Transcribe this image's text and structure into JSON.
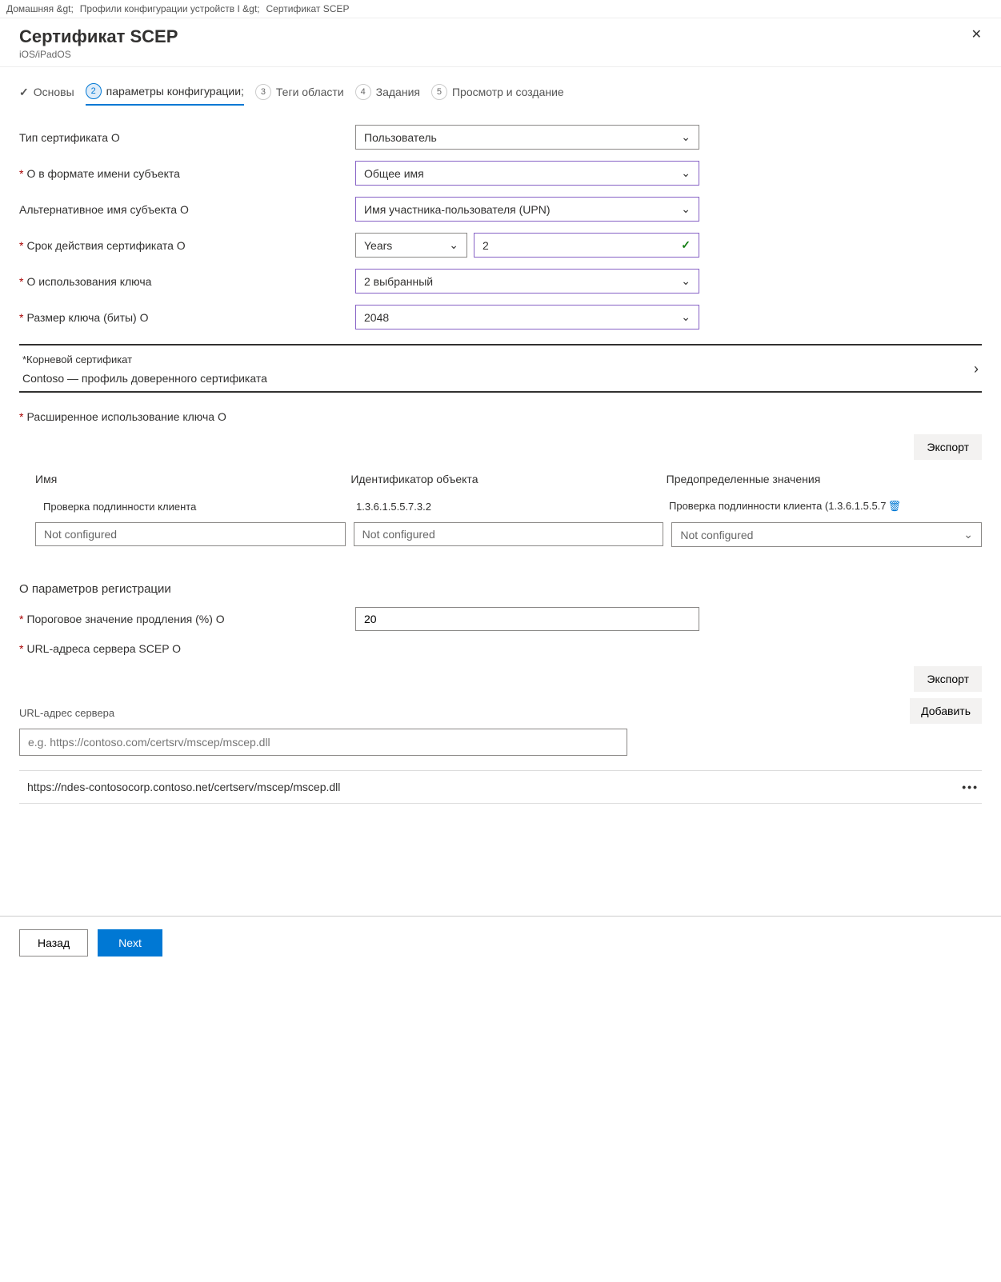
{
  "breadcrumb": {
    "home": "Домашняя &gt;",
    "profiles": "Профили конфигурации устройств I &gt;",
    "cert": "Сертификат SCEP"
  },
  "header": {
    "title": "Сертификат SCEP",
    "subtitle": "iOS/iPadOS"
  },
  "steps": {
    "s1": "Основы",
    "s2": "параметры конфигурации;",
    "s3": "Теги области",
    "s4": "Задания",
    "s5": "Просмотр и создание",
    "n3": "3",
    "n4": "4",
    "n5": "5",
    "n2": "2"
  },
  "fields": {
    "certType": {
      "label": "Тип сертификата О",
      "value": "Пользователь"
    },
    "subjectFormat": {
      "label": "О в формате имени субъекта",
      "value": "Общее имя"
    },
    "san": {
      "label": "Альтернативное имя субъекта О",
      "value": "Имя участника-пользователя (UPN)"
    },
    "validity": {
      "label": "Срок действия сертификата О",
      "unit": "Years",
      "value": "2"
    },
    "keyUsage": {
      "label": "О использования ключа",
      "value": "2 выбранный"
    },
    "keySize": {
      "label": "Размер ключа (биты) О",
      "value": "2048"
    },
    "rootCert": {
      "label": "*Корневой сертификат",
      "value": "Contoso — профиль доверенного сертификата"
    },
    "eku": {
      "label": "Расширенное использование ключа О"
    },
    "export": "Экспорт",
    "ekuTable": {
      "hName": "Имя",
      "hOid": "Идентификатор объекта",
      "hPredef": "Предопределенные значения",
      "rName": "Проверка подлинности клиента",
      "rOid": "1.3.6.1.5.5.7.3.2",
      "rPredef": "Проверка подлинности клиента (1.3.6.1.5.5.7",
      "notConfigured": "Not configured"
    },
    "enrollTitle": "О параметров регистрации",
    "renewal": {
      "label": "Пороговое значение продления (%) О",
      "value": "20"
    },
    "scepUrls": {
      "label": "URL-адреса сервера SCEP О"
    },
    "urlServerLabel": "URL-адрес сервера",
    "addBtn": "Добавить",
    "urlPlaceholder": "e.g. https://contoso.com/certsrv/mscep/mscep.dll",
    "urlEntry": "https://ndes-contosocorp.contoso.net/certserv/mscep/mscep.dll"
  },
  "footer": {
    "back": "Назад",
    "next": "Next"
  }
}
